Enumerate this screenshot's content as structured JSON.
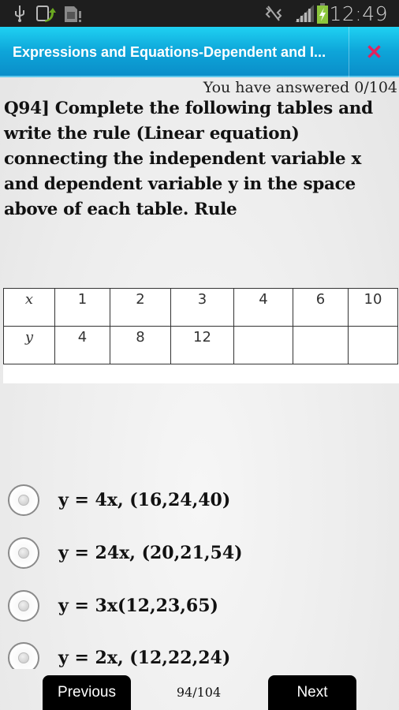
{
  "status_bar": {
    "left_icons": [
      "usb-icon",
      "screen-rotate-icon",
      "sim-card-alert-icon"
    ],
    "right_icons": [
      "vibrate-off-icon",
      "signal-icon",
      "battery-charging-icon"
    ],
    "time": "12:49"
  },
  "header": {
    "title": "Expressions and Equations-Dependent and I...",
    "close_icon": "close-icon",
    "close_color": "#e0245e",
    "accent": "#0ea5d9"
  },
  "progress": {
    "answered_text": "You have answered 0/104"
  },
  "question": {
    "text": "Q94]  Complete the following tables and write the rule (Linear equation) connecting the  independent variable x and dependent variable y in the space above of each table. Rule"
  },
  "table": {
    "rows": [
      {
        "head": "x",
        "cells": [
          "1",
          "2",
          "3",
          "4",
          "6",
          "10"
        ]
      },
      {
        "head": "y",
        "cells": [
          "4",
          "8",
          "12",
          "",
          "",
          ""
        ]
      }
    ]
  },
  "options": [
    {
      "label": "y = 4x, (16,24,40)",
      "selected": false
    },
    {
      "label": "y = 24x, (20,21,54)",
      "selected": false
    },
    {
      "label": "y = 3x(12,23,65)",
      "selected": false
    },
    {
      "label": "y = 2x, (12,22,24)",
      "selected": false
    }
  ],
  "footer": {
    "previous_label": "Previous",
    "page_indicator": "94/104",
    "next_label": "Next"
  }
}
